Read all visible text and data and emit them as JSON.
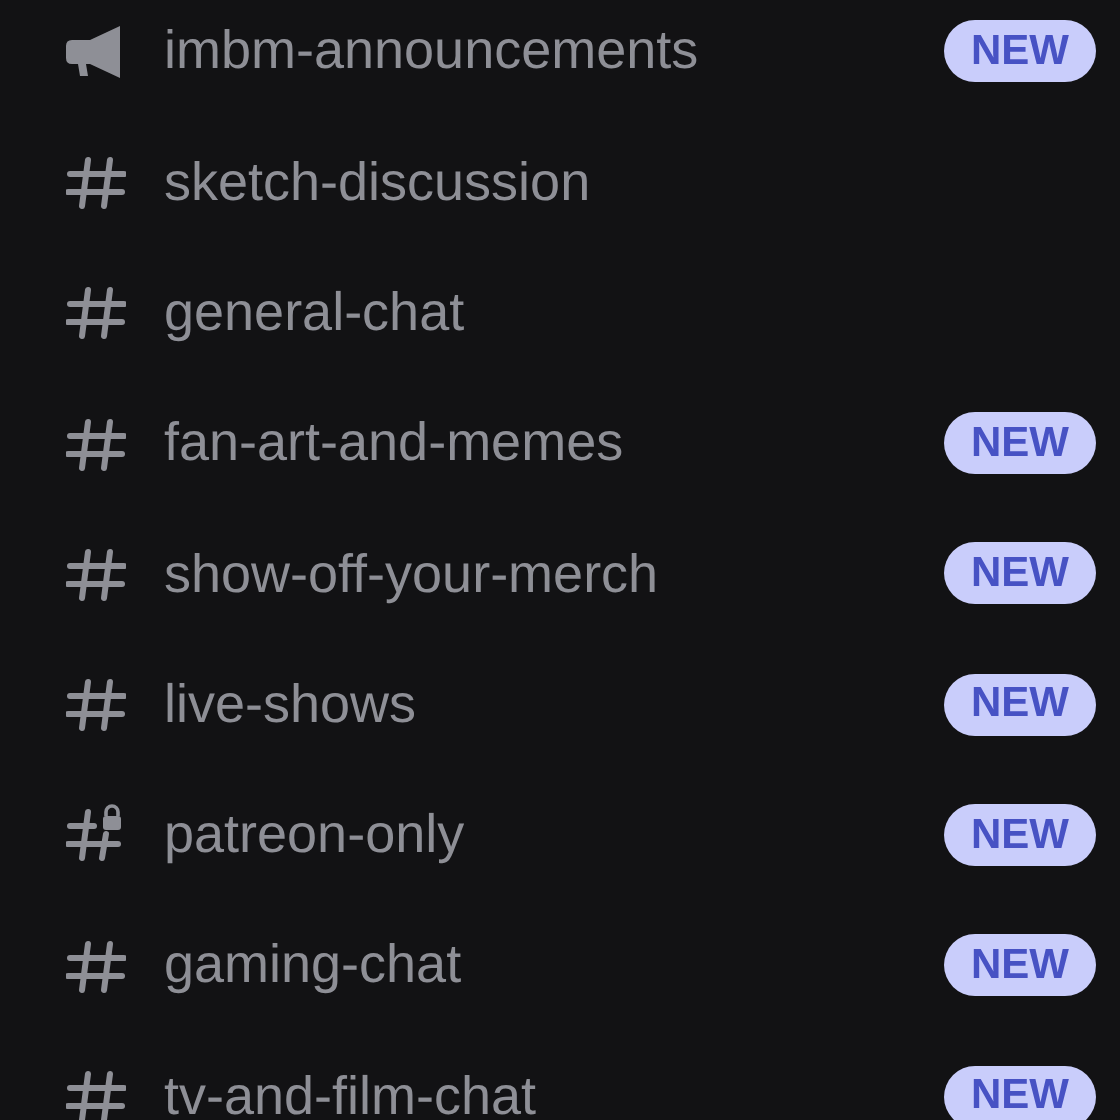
{
  "channels": [
    {
      "kind": "announcement",
      "name": "imbm-announcements",
      "badge": "NEW"
    },
    {
      "kind": "text",
      "name": "sketch-discussion"
    },
    {
      "kind": "text",
      "name": "general-chat"
    },
    {
      "kind": "text",
      "name": "fan-art-and-memes",
      "badge": "NEW"
    },
    {
      "kind": "text",
      "name": "show-off-your-merch",
      "badge": "NEW"
    },
    {
      "kind": "text",
      "name": "live-shows",
      "badge": "NEW"
    },
    {
      "kind": "locked",
      "name": "patreon-only",
      "badge": "NEW"
    },
    {
      "kind": "text",
      "name": "gaming-chat",
      "badge": "NEW"
    },
    {
      "kind": "text",
      "name": "tv-and-film-chat",
      "badge": "NEW"
    }
  ]
}
